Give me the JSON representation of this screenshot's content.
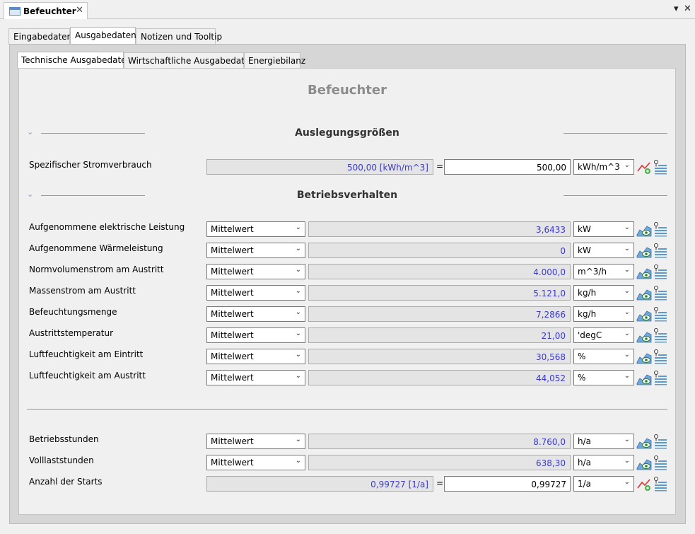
{
  "window": {
    "title": "Befeuchter",
    "close_symbol": "✕",
    "dropdown_symbol": "▾"
  },
  "outer_tabs": [
    "Eingabedaten",
    "Ausgabedaten",
    "Notizen und Tooltip"
  ],
  "inner_tabs": [
    "Technische Ausgabedaten",
    "Wirtschaftliche Ausgabedaten",
    "Energiebilanz"
  ],
  "page_title": "Befeuchter",
  "sections": {
    "auslegung": "Auslegungsgrößen",
    "betrieb": "Betriebsverhalten"
  },
  "rows": [
    {
      "label": "Spezifischer Stromverbrauch",
      "kind": "formula",
      "computed": "500,00 [kWh/m^3]",
      "input": "500,00",
      "unit": "kWh/m^3"
    },
    {
      "label": "Aufgenommene elektrische Leistung",
      "kind": "value",
      "mode": "Mittelwert",
      "value": "3,6433",
      "unit": "kW"
    },
    {
      "label": "Aufgenommene Wärmeleistung",
      "kind": "value",
      "mode": "Mittelwert",
      "value": "0",
      "unit": "kW"
    },
    {
      "label": "Normvolumenstrom am Austritt",
      "kind": "value",
      "mode": "Mittelwert",
      "value": "4.000,0",
      "unit": "m^3/h"
    },
    {
      "label": "Massenstrom am Austritt",
      "kind": "value",
      "mode": "Mittelwert",
      "value": "5.121,0",
      "unit": "kg/h"
    },
    {
      "label": "Befeuchtungsmenge",
      "kind": "value",
      "mode": "Mittelwert",
      "value": "7,2866",
      "unit": "kg/h"
    },
    {
      "label": "Austrittstemperatur",
      "kind": "value",
      "mode": "Mittelwert",
      "value": "21,00",
      "unit": "'degC"
    },
    {
      "label": "Luftfeuchtigkeit am Eintritt",
      "kind": "value",
      "mode": "Mittelwert",
      "value": "30,568",
      "unit": "%"
    },
    {
      "label": "Luftfeuchtigkeit am Austritt",
      "kind": "value",
      "mode": "Mittelwert",
      "value": "44,052",
      "unit": "%"
    },
    {
      "label": "Betriebsstunden",
      "kind": "value",
      "mode": "Mittelwert",
      "value": "8.760,0",
      "unit": "h/a"
    },
    {
      "label": "Volllaststunden",
      "kind": "value",
      "mode": "Mittelwert",
      "value": "638,30",
      "unit": "h/a"
    },
    {
      "label": "Anzahl der Starts",
      "kind": "formula",
      "computed": "0,99727 [1/a]",
      "input": "0,99727",
      "unit": "1/a"
    }
  ],
  "symbols": {
    "equals": "=",
    "chevron": "⌄",
    "arrow": "⌄"
  },
  "icons": {
    "formula_chart": "chart-add-icon",
    "value_chart": "chart-view-icon",
    "list": "pin-list-icon"
  },
  "colors": {
    "computed_text": "#3a3acc",
    "panel_bg": "#f0f0f0",
    "frame_bg": "#d6d6d6",
    "title_gray": "#8c8c8c"
  }
}
